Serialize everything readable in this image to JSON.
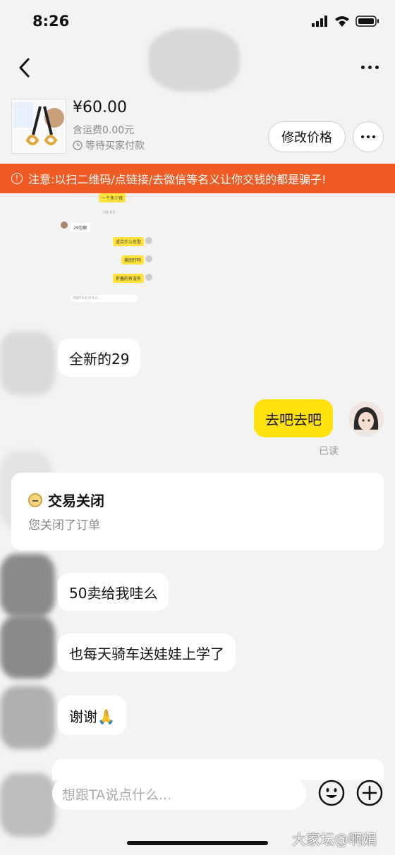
{
  "status_bar": {
    "time": "8:26"
  },
  "product": {
    "price": "¥60.00",
    "shipping": "含运费0.00元",
    "status": "等待买家付款",
    "edit_price_button": "修改价格"
  },
  "warning": "注意:以扫二维码/点链接/去微信等名义让你交钱的都是骗子!",
  "embedded_screenshot": {
    "time": "08:00",
    "user_msg": "29包邮",
    "msgs": [
      "适合什么车型",
      "美团行吗",
      "折叠的有没有"
    ],
    "placeholder": "想跟TA说点什么..."
  },
  "messages": [
    {
      "side": "left",
      "text": "全新的29"
    },
    {
      "side": "right",
      "text": "去吧去吧",
      "status": "已读"
    }
  ],
  "order_card": {
    "title": "交易关闭",
    "subtitle": "您关闭了订单"
  },
  "messages_after": [
    {
      "side": "left",
      "text": "50卖给我哇么"
    },
    {
      "side": "left",
      "text": "也每天骑车送娃娃上学了"
    },
    {
      "side": "left",
      "text": "谢谢🙏"
    }
  ],
  "input": {
    "placeholder": "想跟TA说点什么..."
  },
  "watermark": "大家坛@啊娟"
}
